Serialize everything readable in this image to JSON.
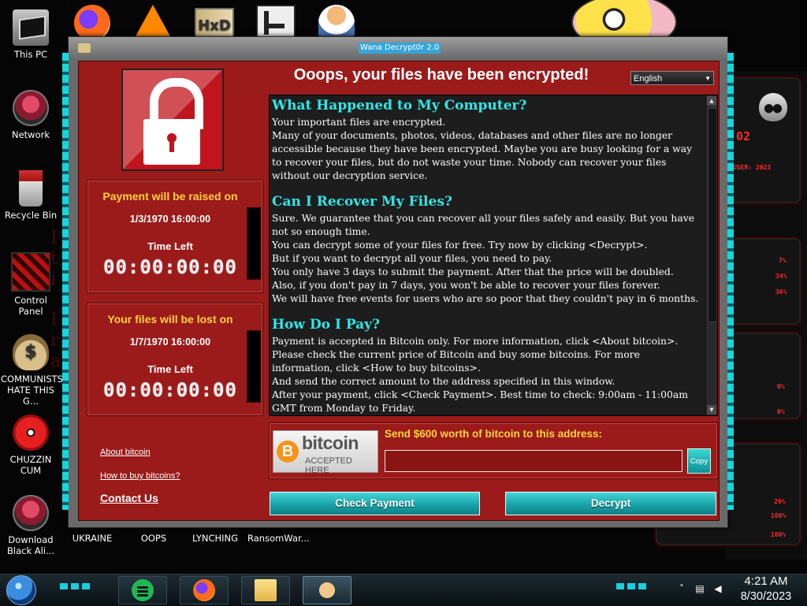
{
  "desktop": {
    "left_icons": [
      {
        "label": "This PC",
        "icon": "computer-icon"
      },
      {
        "label": "Network",
        "icon": "alien-network-icon"
      },
      {
        "label": "Recycle Bin",
        "icon": "recycle-bin-icon"
      },
      {
        "label": "Control Panel",
        "icon": "control-panel-icon"
      },
      {
        "label": "COMMUNISTS HATE THIS G...",
        "icon": "money-bag-icon"
      },
      {
        "label": "CHUZZIN CUM",
        "icon": "chuzzle-icon"
      },
      {
        "label": "Download Black Ali...",
        "icon": "alien-download-icon"
      }
    ],
    "top_icons": [
      {
        "icon": "firefox-icon"
      },
      {
        "icon": "vlc-icon"
      },
      {
        "icon": "hxd-icon",
        "text": "HxD"
      },
      {
        "icon": "maze-app-icon"
      },
      {
        "icon": "person-icon"
      }
    ],
    "bottom_row_labels": [
      "UKRAINE",
      "OOPS",
      "LYNCHING",
      "RansomWar..."
    ]
  },
  "gadgets": {
    "clock_fragment": "02",
    "user_fragment": "USER: 2023",
    "readouts": [
      "7%",
      "34%",
      "36%",
      "0%",
      "0%",
      "26%",
      "100%",
      "100%"
    ]
  },
  "wanna": {
    "window_title": "Wana Decrypt0r 2.0",
    "headline": "Ooops, your files have been encrypted!",
    "language": "English",
    "raise_box": {
      "title": "Payment will be raised on",
      "date": "1/3/1970 16:00:00",
      "time_left_label": "Time Left",
      "countdown": "00:00:00:00"
    },
    "lost_box": {
      "title": "Your files will be lost on",
      "date": "1/7/1970 16:00:00",
      "time_left_label": "Time Left",
      "countdown": "00:00:00:00"
    },
    "links": {
      "about_bitcoin": "About bitcoin",
      "how_to_buy": "How to buy bitcoins?",
      "contact": "Contact Us"
    },
    "sections": [
      {
        "heading": "What Happened to My Computer?",
        "paragraphs": [
          "Your important files are encrypted.",
          "Many of your documents, photos, videos, databases and other files are no longer accessible because they have been encrypted. Maybe you are busy looking for a way to recover your files, but do not waste your time. Nobody can recover your files without our decryption service."
        ]
      },
      {
        "heading": "Can I Recover My Files?",
        "paragraphs": [
          "Sure. We guarantee that you can recover all your files safely and easily. But you have not so enough time.",
          "You can decrypt some of your files for free. Try now by clicking <Decrypt>.",
          "But if you want to decrypt all your files, you need to pay.",
          "You only have 3 days to submit the payment. After that the price will be doubled.",
          "Also, if you don't pay in 7 days, you won't be able to recover your files forever.",
          "We will have free events for users who are so poor that they couldn't pay in 6 months."
        ]
      },
      {
        "heading": "How Do I Pay?",
        "paragraphs": [
          "Payment is accepted in Bitcoin only. For more information, click <About bitcoin>.",
          "Please check the current price of Bitcoin and buy some bitcoins. For more information, click <How to buy bitcoins>.",
          "And send the correct amount to the address specified in this window.",
          "After your payment, click <Check Payment>. Best time to check: 9:00am - 11:00am GMT from Monday to Friday."
        ]
      }
    ],
    "bitcoin_badge": {
      "symbol": "B",
      "word": "bitcoin",
      "sub": "ACCEPTED HERE"
    },
    "send_label": "Send $600 worth of bitcoin to this address:",
    "address": "",
    "copy_label": "Copy",
    "check_payment_label": "Check Payment",
    "decrypt_label": "Decrypt"
  },
  "taskbar": {
    "apps": [
      {
        "icon": "spotify-icon"
      },
      {
        "icon": "firefox-icon"
      },
      {
        "icon": "file-explorer-icon"
      },
      {
        "icon": "wannacry-handshake-icon"
      }
    ],
    "tray_icons": [
      "chevron-up-icon",
      "network-icon",
      "volume-icon"
    ],
    "clock_time": "4:21 AM",
    "clock_date": "8/30/2023"
  },
  "colors": {
    "window_body": "#9b1b1b",
    "heading_cyan": "#2fe8e8",
    "timer_title_yellow": "#ffd23b",
    "button_teal": "#1aa7ad"
  }
}
